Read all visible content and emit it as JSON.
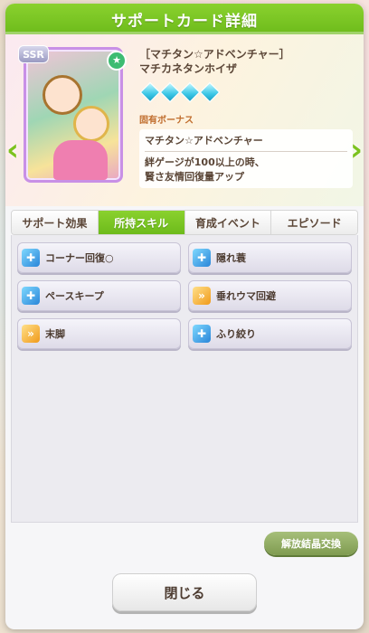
{
  "dialog": {
    "title": "サポートカード詳細"
  },
  "card": {
    "rarity": "SSR",
    "title": "［マチタン☆アドベンチャー］",
    "name": "マチカネタンホイザ",
    "diamond_count": 4,
    "unique_bonus_label": "固有ボーナス",
    "unique_bonus_name": "マチタン☆アドベンチャー",
    "unique_bonus_desc_line1": "絆ゲージが100以上の時、",
    "unique_bonus_desc_line2": "賢さ友情回復量アップ"
  },
  "tabs": [
    {
      "label": "サポート効果",
      "active": false
    },
    {
      "label": "所持スキル",
      "active": true
    },
    {
      "label": "育成イベント",
      "active": false
    },
    {
      "label": "エピソード",
      "active": false
    }
  ],
  "skills": [
    {
      "label": "コーナー回復○",
      "icon": "recovery-icon",
      "color": "blue"
    },
    {
      "label": "隠れ蓑",
      "icon": "recovery-icon",
      "color": "blue"
    },
    {
      "label": "ペースキープ",
      "icon": "recovery-icon",
      "color": "blue"
    },
    {
      "label": "垂れウマ回避",
      "icon": "speed-icon",
      "color": "orange"
    },
    {
      "label": "末脚",
      "icon": "speed-icon",
      "color": "orange"
    },
    {
      "label": "ふり絞り",
      "icon": "recovery-icon",
      "color": "blue"
    }
  ],
  "buttons": {
    "exchange_label": "解放結晶交換",
    "close_label": "閉じる"
  },
  "colors": {
    "accent_green": "#7cc21f",
    "skill_blue": "#2a86d8",
    "skill_orange": "#f09a1a"
  }
}
